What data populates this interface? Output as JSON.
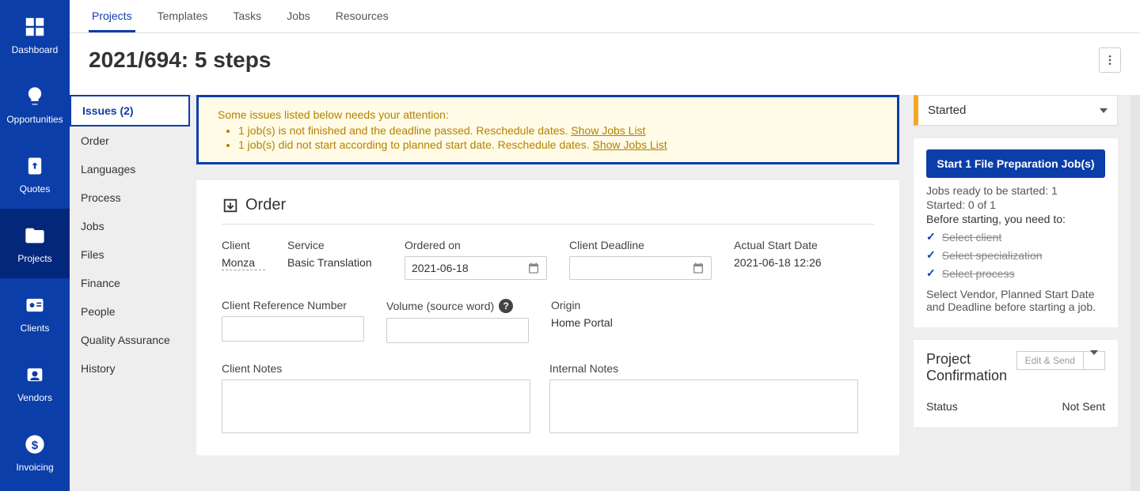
{
  "sidebar": {
    "items": [
      {
        "label": "Dashboard",
        "icon": "dashboard"
      },
      {
        "label": "Opportunities",
        "icon": "bulb"
      },
      {
        "label": "Quotes",
        "icon": "quote"
      },
      {
        "label": "Projects",
        "icon": "folder",
        "active": true
      },
      {
        "label": "Clients",
        "icon": "clients"
      },
      {
        "label": "Vendors",
        "icon": "vendor"
      },
      {
        "label": "Invoicing",
        "icon": "invoice"
      }
    ]
  },
  "top_tabs": [
    "Projects",
    "Templates",
    "Tasks",
    "Jobs",
    "Resources"
  ],
  "top_tabs_active": 0,
  "page_title": "2021/694:  5 steps",
  "sections": [
    {
      "label": "Issues (2)",
      "active": true
    },
    {
      "label": "Order"
    },
    {
      "label": "Languages"
    },
    {
      "label": "Process"
    },
    {
      "label": "Jobs"
    },
    {
      "label": "Files"
    },
    {
      "label": "Finance"
    },
    {
      "label": "People"
    },
    {
      "label": "Quality Assurance"
    },
    {
      "label": "History"
    }
  ],
  "issues_banner": {
    "intro": "Some issues listed below needs your attention:",
    "line1_a": "1 job(s) is not finished and the deadline passed. Reschedule dates. ",
    "line1_link": "Show Jobs List",
    "line2_a": "1 job(s) did not start according to planned start date. Reschedule dates. ",
    "line2_link": "Show Jobs List"
  },
  "order_panel": {
    "title": "Order",
    "fields": {
      "client_label": "Client",
      "client_value": "Monza",
      "service_label": "Service",
      "service_value": "Basic Translation",
      "ordered_on_label": "Ordered on",
      "ordered_on_value": "2021-06-18",
      "client_deadline_label": "Client Deadline",
      "client_deadline_value": "",
      "actual_start_label": "Actual Start Date",
      "actual_start_value": "2021-06-18 12:26",
      "client_ref_label": "Client Reference Number",
      "client_ref_value": "",
      "volume_label": "Volume (source word)",
      "volume_value": "",
      "origin_label": "Origin",
      "origin_value": "Home Portal",
      "client_notes_label": "Client Notes",
      "client_notes_value": "",
      "internal_notes_label": "Internal Notes",
      "internal_notes_value": ""
    }
  },
  "status_dropdown": "Started",
  "start_panel": {
    "button": "Start 1 File Preparation Job(s)",
    "ready": "Jobs ready to be started: 1",
    "started": "Started: 0 of 1",
    "before": "Before starting, you need to:",
    "checks": [
      "Select client",
      "Select specialization",
      "Select process"
    ],
    "hint": "Select Vendor, Planned Start Date and Deadline before starting a job."
  },
  "confirmation_panel": {
    "title1": "Project",
    "title2": "Confirmation",
    "button": "Edit & Send",
    "status_label": "Status",
    "status_value": "Not Sent"
  }
}
